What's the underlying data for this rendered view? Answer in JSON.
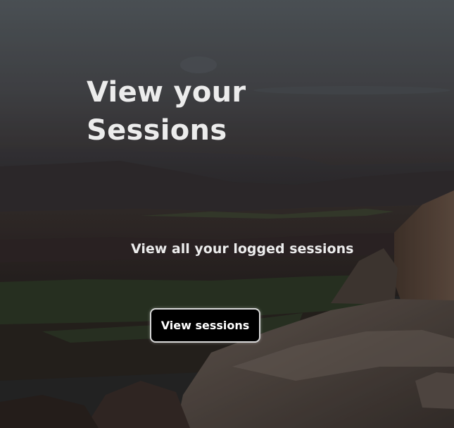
{
  "hero": {
    "title_line1": "View your",
    "title_line2": "Sessions",
    "subtitle": "View all your logged sessions",
    "button_label": "View sessions"
  },
  "colors": {
    "text": "#ececec",
    "button_bg": "#000000",
    "button_border": "#d8d8d8"
  }
}
